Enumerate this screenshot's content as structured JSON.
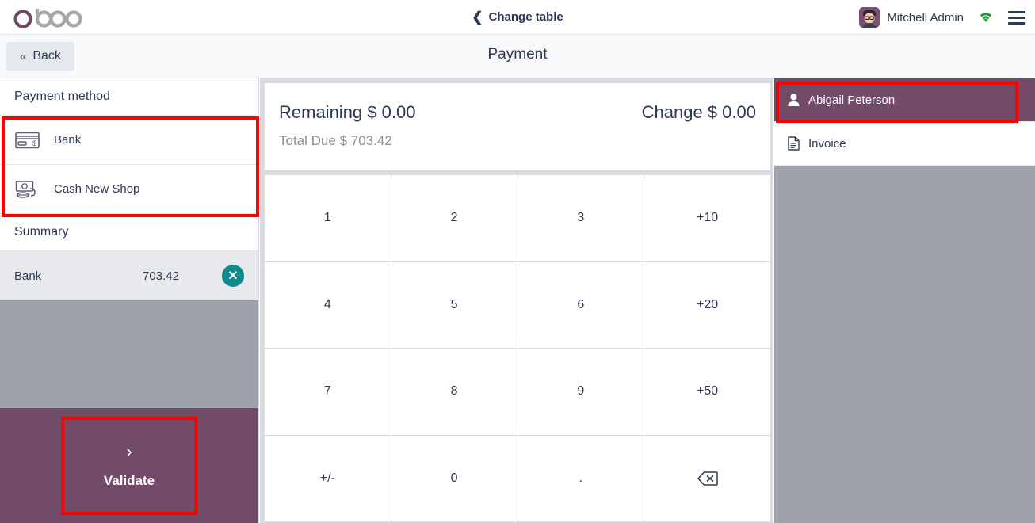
{
  "topbar": {
    "logo_text": "odoo",
    "change_table_label": "Change table",
    "back_chevron_icon": "chevron-left-icon",
    "user_name": "Mitchell Admin",
    "wifi_icon": "wifi-icon",
    "menu_icon": "hamburger-menu-icon",
    "avatar_icon": "user-avatar"
  },
  "subheader": {
    "back_label": "Back",
    "back_chevrons": "«",
    "page_title": "Payment"
  },
  "left_panel": {
    "payment_method_title": "Payment method",
    "payment_methods": [
      {
        "label": "Bank",
        "icon": "credit-card-icon"
      },
      {
        "label": "Cash New Shop",
        "icon": "cash-money-icon"
      }
    ],
    "summary_title": "Summary",
    "summary_rows": [
      {
        "name": "Bank",
        "amount": "703.42",
        "delete_icon": "close-circle-icon"
      }
    ],
    "validate": {
      "label": "Validate",
      "chevron": "›",
      "icon": "chevron-right-icon"
    }
  },
  "center_panel": {
    "remaining_label": "Remaining",
    "remaining_value": "$ 0.00",
    "change_label": "Change",
    "change_value": "$ 0.00",
    "total_due_label": "Total Due",
    "total_due_value": "$ 703.42",
    "numpad_keys": [
      "1",
      "2",
      "3",
      "+10",
      "4",
      "5",
      "6",
      "+20",
      "7",
      "8",
      "9",
      "+50",
      "+/-",
      "0",
      ".",
      "backspace"
    ],
    "backspace_icon": "backspace-icon"
  },
  "right_panel": {
    "customer": {
      "label": "Abigail Peterson",
      "icon": "person-icon",
      "selected": true
    },
    "invoice": {
      "label": "Invoice",
      "icon": "document-icon",
      "selected": false
    }
  },
  "colors": {
    "brand_purple": "#714b67",
    "gray_panel": "#9da1aa",
    "annotation_red": "#fe0000",
    "teal_delete": "#0f8a8f",
    "text_navy": "#2d3a54",
    "muted_gray": "#8a8f98"
  }
}
